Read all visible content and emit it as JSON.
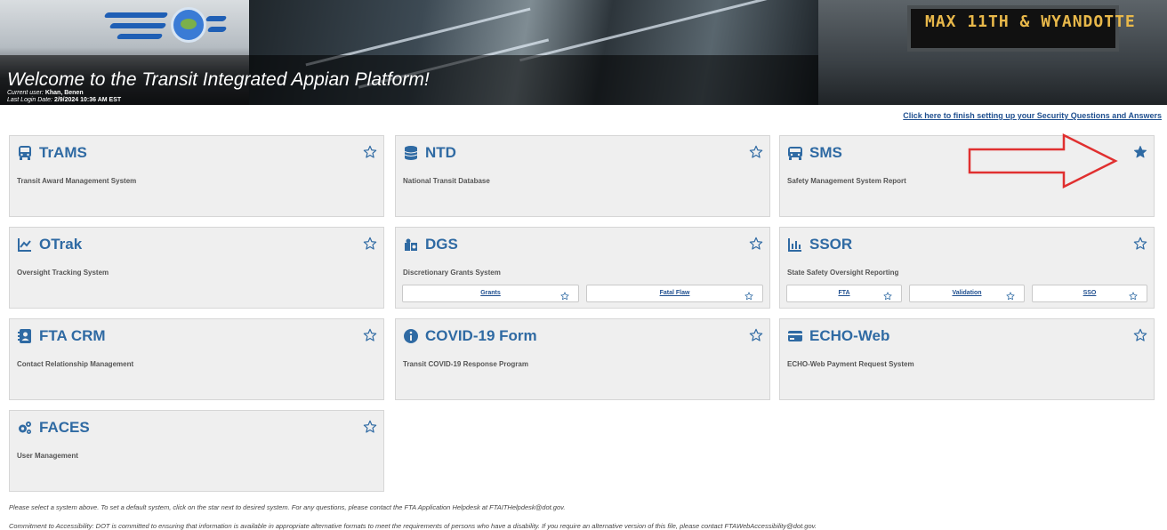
{
  "banner": {
    "welcome": "Welcome to the Transit Integrated Appian Platform!",
    "current_user_label": "Current user:",
    "current_user": "Khan, Benen",
    "last_login_label": "Last Login Date:",
    "last_login": "2/9/2024 10:36 AM EST",
    "sign_text": "MAX 11TH & WYANDOTTE"
  },
  "security_link": "Click here to finish setting up your Security Questions and Answers",
  "systems": [
    {
      "title": "TrAMS",
      "desc": "Transit Award Management System",
      "icon": "bus-icon",
      "starred": false
    },
    {
      "title": "NTD",
      "desc": "National Transit Database",
      "icon": "database-icon",
      "starred": false
    },
    {
      "title": "SMS",
      "desc": "Safety Management System Report",
      "icon": "bus-side-icon",
      "starred": true
    },
    {
      "title": "OTrak",
      "desc": "Oversight Tracking System",
      "icon": "line-chart-icon",
      "starred": false
    },
    {
      "title": "DGS",
      "desc": "Discretionary Grants System",
      "icon": "puzzle-icon",
      "starred": false,
      "sub": [
        {
          "label": "Grants"
        },
        {
          "label": "Fatal Flaw"
        }
      ]
    },
    {
      "title": "SSOR",
      "desc": "State Safety Oversight Reporting",
      "icon": "bar-chart-icon",
      "starred": false,
      "sub": [
        {
          "label": "FTA"
        },
        {
          "label": "Validation"
        },
        {
          "label": "SSO"
        }
      ]
    },
    {
      "title": "FTA CRM",
      "desc": "Contact Relationship Management",
      "icon": "contact-book-icon",
      "starred": false
    },
    {
      "title": "COVID-19 Form",
      "desc": "Transit COVID-19 Response Program",
      "icon": "info-circle-icon",
      "starred": false
    },
    {
      "title": "ECHO-Web",
      "desc": "ECHO-Web Payment Request System",
      "icon": "credit-card-icon",
      "starred": false
    },
    {
      "title": "FACES",
      "desc": "User Management",
      "icon": "cogs-icon",
      "starred": false
    }
  ],
  "footer": {
    "instructions": "Please select a system above. To set a default system, click on the star next to desired system. For any questions, please contact the FTA Application Helpdesk at FTAITHelpdesk@dot.gov.",
    "accessibility": "Commitment to Accessibility: DOT is committed to ensuring that information is available in appropriate alternative formats to meet the requirements of persons who have a disability. If you require an alternative version of this file, please contact FTAWebAccessibility@dot.gov."
  },
  "colors": {
    "title": "#2f6aa3",
    "card_bg": "#efefef",
    "annotation_arrow": "#e03030"
  }
}
